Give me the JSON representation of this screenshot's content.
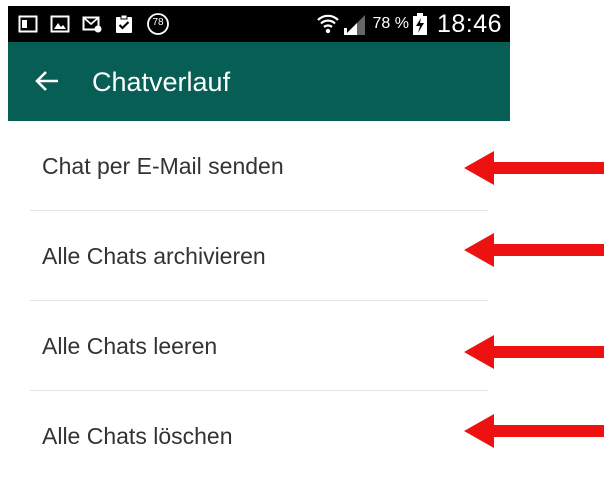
{
  "status_bar": {
    "notification_icons": [
      "app-window-icon",
      "gallery-icon",
      "mail-icon",
      "clipboard-check-icon",
      "badge-icon"
    ],
    "badge_count": "78",
    "signal_icons": [
      "wifi-icon",
      "cellular-signal-icon"
    ],
    "battery_percent": "78 %",
    "time": "18:46"
  },
  "app_bar": {
    "back_icon": "arrow-left-icon",
    "title": "Chatverlauf"
  },
  "menu": {
    "items": [
      {
        "label": "Chat per E-Mail senden"
      },
      {
        "label": "Alle Chats archivieren"
      },
      {
        "label": "Alle Chats leeren"
      },
      {
        "label": "Alle Chats löschen"
      }
    ]
  },
  "colors": {
    "app_bar": "#075e54",
    "status_bar": "#000000",
    "annotation_arrow": "#ee1111",
    "text": "#333333"
  }
}
